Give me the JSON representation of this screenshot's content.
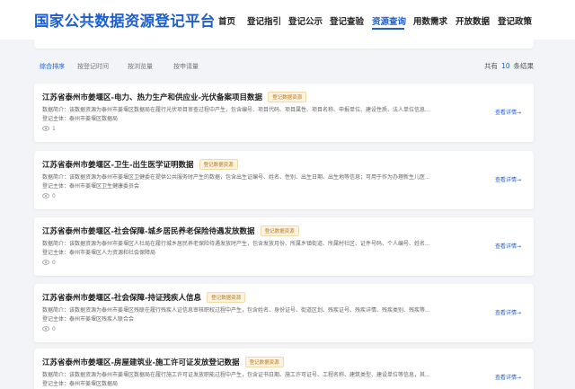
{
  "header": {
    "logo": "国家公共数据资源登记平台",
    "nav": [
      {
        "label": "首页"
      },
      {
        "label": "登记指引"
      },
      {
        "label": "登记公示"
      },
      {
        "label": "登记查验"
      },
      {
        "label": "资源查询"
      },
      {
        "label": "用数需求"
      },
      {
        "label": "开放数据"
      },
      {
        "label": "登记政策"
      }
    ],
    "active_nav": "资源查询"
  },
  "sortbar": {
    "items": [
      "综合排序",
      "按登记时间",
      "按浏览量",
      "按申请量"
    ],
    "active": "综合排序",
    "count_prefix": "共有",
    "count": "10",
    "count_suffix": "条结果"
  },
  "results": [
    {
      "title": "江苏省泰州市姜堰区-电力、热力生产和供应业-光伏备案项目数据",
      "badge": "登记数据资源",
      "desc": "数据简介：该数据资源为泰州市姜堰区数据局在履行光伏项目审查过程中产生，包含编号、项目代码、项目属性、项目名称、申报单位、建设性质、法人单位信息...",
      "subject": "登记主体：泰州市姜堰区数据局",
      "views": "1",
      "link": "查看详情→"
    },
    {
      "title": "江苏省泰州市姜堰区-卫生-出生医学证明数据",
      "badge": "登记数据资源",
      "desc": "数据简介：该数据资源为泰州市姜堰区卫健委在提供公共服务时产生的数据，包含出生证编号、姓名、性别、出生日期、出生地等信息；可用于作为办理新生儿医...",
      "subject": "登记主体：泰州市姜堰区卫生健康委员会",
      "views": "0",
      "link": "查看详情→"
    },
    {
      "title": "江苏省泰州市姜堰区-社会保障-城乡居民养老保险待遇发放数据",
      "badge": "登记数据资源",
      "desc": "数据简介：该数据资源为泰州市姜堰区人社局在履行城乡居民养老保险待遇发放时产生，包含发放月份、所属乡镇街道、所属村社区、证件号码、个人编号、姓名...",
      "subject": "登记主体：泰州市姜堰区人力资源和社会保障局",
      "views": "0",
      "link": "查看详情→"
    },
    {
      "title": "江苏省泰州市姜堰区-社会保障-持证残疾人信息",
      "badge": "登记数据资源",
      "desc": "数据简介：该数据资源为泰州市姜堰区残联在履行残疾人证信息审核职权过程中产生，包含姓名、身份证号、街道区划、残疾证号、残疾详情、残疾类别、残疾等...",
      "subject": "登记主体：泰州市姜堰区残疾人联合会",
      "views": "0",
      "link": "查看详情→"
    },
    {
      "title": "江苏省泰州市姜堰区-房屋建筑业-施工许可证发放登记数据",
      "badge": "登记数据资源",
      "desc": "数据简介：该数据资源为泰州市姜堰区数据局在履行施工许可证发放职能过程中产生，包含证书日期、施工许可证号、工程名称、建筑类型、建设单位等信息，其...",
      "subject": "登记主体：泰州市姜堰区数据局",
      "views": "",
      "link": "查看详情→"
    }
  ]
}
